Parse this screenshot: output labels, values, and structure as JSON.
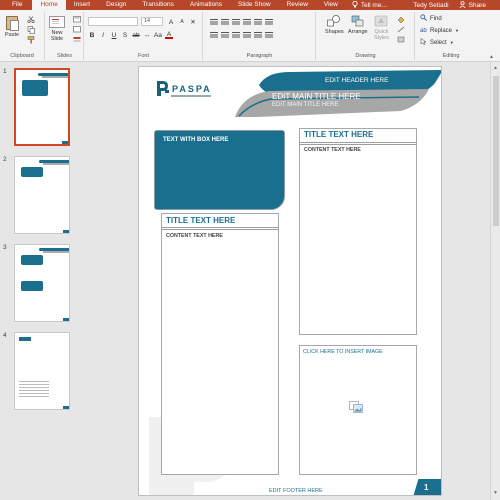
{
  "tabs": [
    {
      "label": "File",
      "active": false
    },
    {
      "label": "Home",
      "active": true
    },
    {
      "label": "Insert",
      "active": false
    },
    {
      "label": "Design",
      "active": false
    },
    {
      "label": "Transitions",
      "active": false
    },
    {
      "label": "Animations",
      "active": false
    },
    {
      "label": "Slide Show",
      "active": false
    },
    {
      "label": "Review",
      "active": false
    },
    {
      "label": "View",
      "active": false
    }
  ],
  "tell_me": "Tell me...",
  "user": "Tedy Setiadi",
  "share": "Share",
  "ribbon": {
    "paste": "Paste",
    "new_slide_line1": "New",
    "new_slide_line2": "Slide",
    "font_size": "14",
    "shapes": "Shapes",
    "arrange": "Arrange",
    "quick_styles_line1": "Quick",
    "quick_styles_line2": "Styles",
    "find": "Find",
    "replace": "Replace",
    "select": "Select",
    "groups": {
      "clipboard": "Clipboard",
      "slides": "Slides",
      "font": "Font",
      "paragraph": "Paragraph",
      "drawing": "Drawing",
      "editing": "Editing"
    }
  },
  "thumbnails": [
    {
      "num": "1"
    },
    {
      "num": "2"
    },
    {
      "num": "3"
    },
    {
      "num": "4"
    }
  ],
  "slide": {
    "logo": "PASPA",
    "header": "EDIT HEADER HERE",
    "main_title": "EDIT MAIN TITLE HERE",
    "main_subtitle": "EDIT MAIN TITLE HERE",
    "box_text": "TEXT WITH BOX HERE",
    "left_title": "TITLE TEXT HERE",
    "left_content": "CONTENT TEXT HERE",
    "right_title": "TITLE TEXT HERE",
    "right_content": "CONTENT TEXT HERE",
    "image_placeholder": "CLICK HERE TO INSERT IMAGE",
    "footer": "EDIT FOOTER HERE",
    "page_number": "1"
  },
  "colors": {
    "ribbon_accent": "#b7472a",
    "slide_teal": "#1b6f8e",
    "slide_gray": "#a7a7a7"
  }
}
